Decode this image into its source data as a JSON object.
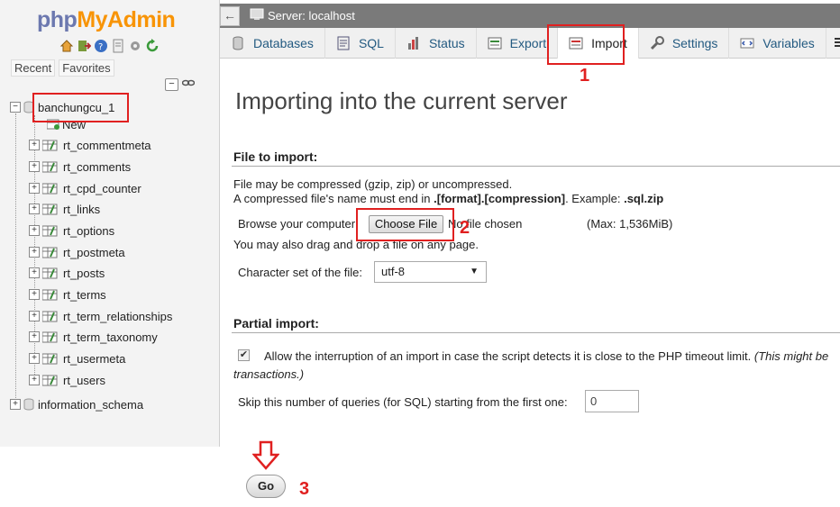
{
  "nav": {
    "logo_php": "php",
    "logo_myadmin": "MyAdmin",
    "icons": [
      "home-icon",
      "exit-icon",
      "help-icon",
      "docs-icon",
      "settings-icon",
      "reload-icon"
    ],
    "tabs": [
      "Recent",
      "Favorites"
    ],
    "databases": [
      {
        "name": "banchungcu_1",
        "expanded": true,
        "new_label": "New",
        "tables": [
          "rt_commentmeta",
          "rt_comments",
          "rt_cpd_counter",
          "rt_links",
          "rt_options",
          "rt_postmeta",
          "rt_posts",
          "rt_terms",
          "rt_term_relationships",
          "rt_term_taxonomy",
          "rt_usermeta",
          "rt_users"
        ]
      },
      {
        "name": "information_schema",
        "expanded": false
      }
    ]
  },
  "topbar": {
    "back": "←",
    "server_label": "Server: localhost"
  },
  "tabs": [
    {
      "label": "Databases",
      "icon": "database-icon"
    },
    {
      "label": "SQL",
      "icon": "sql-icon"
    },
    {
      "label": "Status",
      "icon": "status-icon"
    },
    {
      "label": "Export",
      "icon": "export-icon"
    },
    {
      "label": "Import",
      "icon": "import-icon",
      "active": true
    },
    {
      "label": "Settings",
      "icon": "wrench-icon"
    },
    {
      "label": "Variables",
      "icon": "variables-icon"
    }
  ],
  "main": {
    "title": "Importing into the current server",
    "file_section": {
      "heading": "File to import:",
      "line1": "File may be compressed (gzip, zip) or uncompressed.",
      "line2_prefix": "A compressed file's name must end in ",
      "line2_format": ".[format].[compression]",
      "line2_mid": ". Example: ",
      "line2_example": ".sql.zip",
      "browse_label": "Browse your computer:",
      "choose_file": "Choose File",
      "no_file": "No file chosen",
      "max_size": "(Max: 1,536MiB)",
      "drag_hint": "You may also drag and drop a file on any page.",
      "charset_label": "Character set of the file:",
      "charset_value": "utf-8"
    },
    "partial_section": {
      "heading": "Partial import:",
      "interrupt_checked": true,
      "interrupt_text": "Allow the interruption of an import in case the script detects it is close to the PHP timeout limit.",
      "interrupt_italic": "(This might be",
      "interrupt_italic2": "transactions.)",
      "skip_label": "Skip this number of queries (for SQL) starting from the first one:",
      "skip_value": "0"
    },
    "go": "Go"
  },
  "annotations": {
    "color": "#e02020",
    "labels": [
      "1",
      "2",
      "3"
    ]
  }
}
